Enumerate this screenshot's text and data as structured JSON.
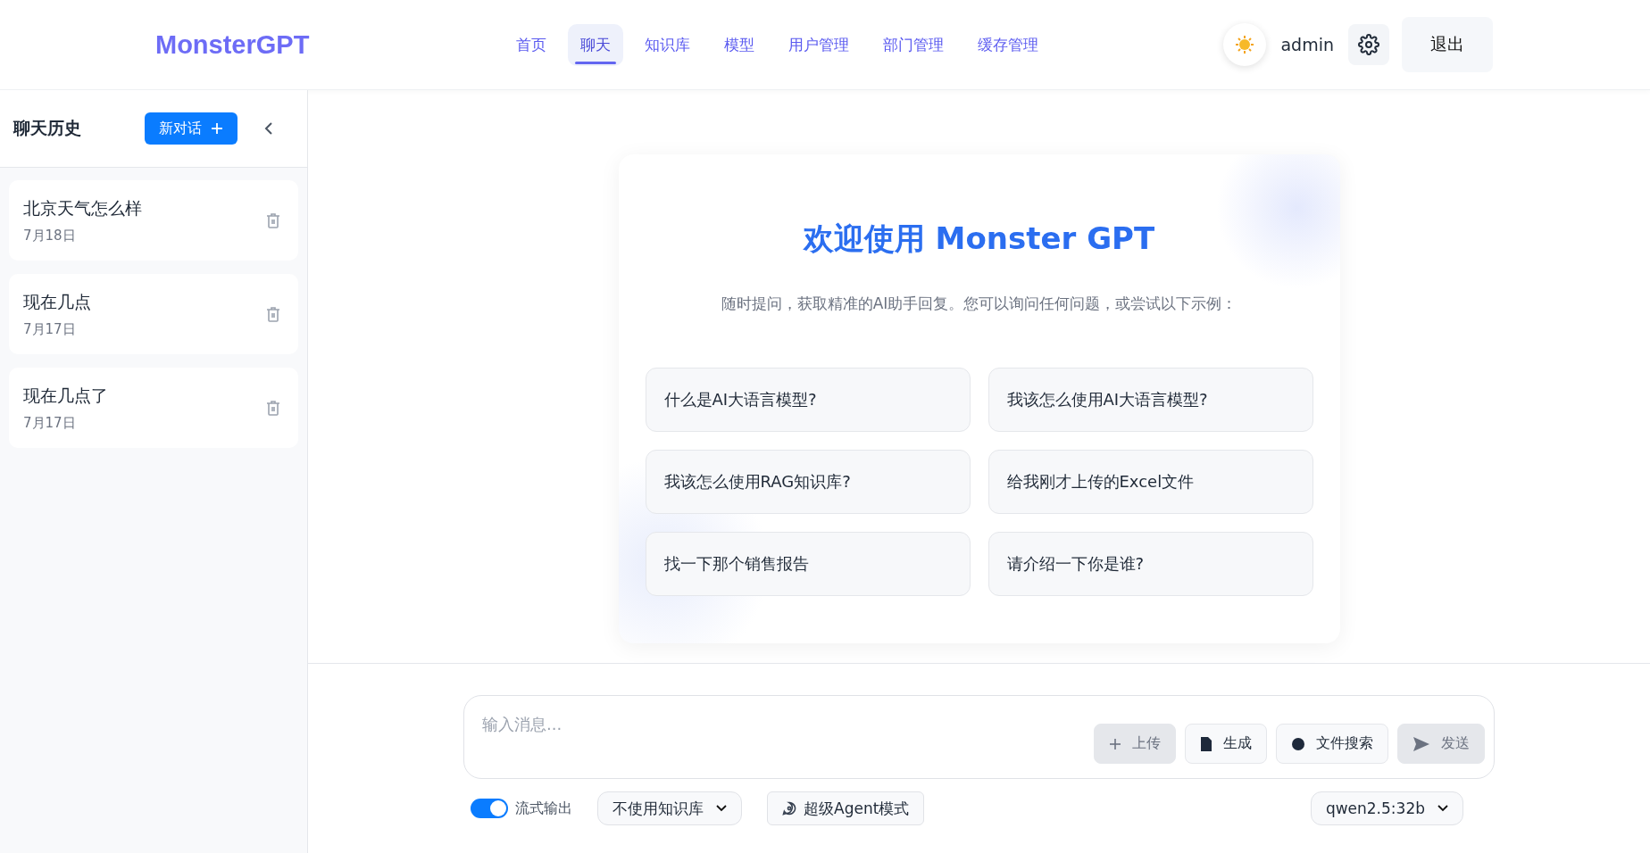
{
  "header": {
    "logo": "MonsterGPT",
    "nav": [
      {
        "label": "首页",
        "selected": false
      },
      {
        "label": "聊天",
        "selected": true
      },
      {
        "label": "知识库",
        "selected": false
      },
      {
        "label": "模型",
        "selected": false
      },
      {
        "label": "用户管理",
        "selected": false
      },
      {
        "label": "部门管理",
        "selected": false
      },
      {
        "label": "缓存管理",
        "selected": false
      }
    ],
    "user": "admin",
    "logout": "退出"
  },
  "sidebar": {
    "title": "聊天历史",
    "new_chat": "新对话",
    "history": [
      {
        "title": "北京天气怎么样",
        "date": "7月18日"
      },
      {
        "title": "现在几点",
        "date": "7月17日"
      },
      {
        "title": "现在几点了",
        "date": "7月17日"
      }
    ]
  },
  "welcome": {
    "title": "欢迎使用 Monster GPT",
    "subtitle": "随时提问，获取精准的AI助手回复。您可以询问任何问题，或尝试以下示例：",
    "suggestions": [
      "什么是AI大语言模型?",
      "我该怎么使用AI大语言模型?",
      "我该怎么使用RAG知识库?",
      "给我刚才上传的Excel文件",
      "找一下那个销售报告",
      "请介绍一下你是谁?"
    ]
  },
  "composer": {
    "placeholder": "输入消息...",
    "actions": [
      {
        "kind": "upload",
        "label": "上传",
        "disabled": true
      },
      {
        "kind": "generate",
        "label": "生成",
        "disabled": false
      },
      {
        "kind": "search",
        "label": "文件搜索",
        "disabled": false
      },
      {
        "kind": "send",
        "label": "发送",
        "disabled": true
      }
    ],
    "stream": {
      "label": "流式输出",
      "on": true
    },
    "knowledge_base": "不使用知识库",
    "agent_mode": "超级Agent模式",
    "model": "qwen2.5:32b"
  }
}
